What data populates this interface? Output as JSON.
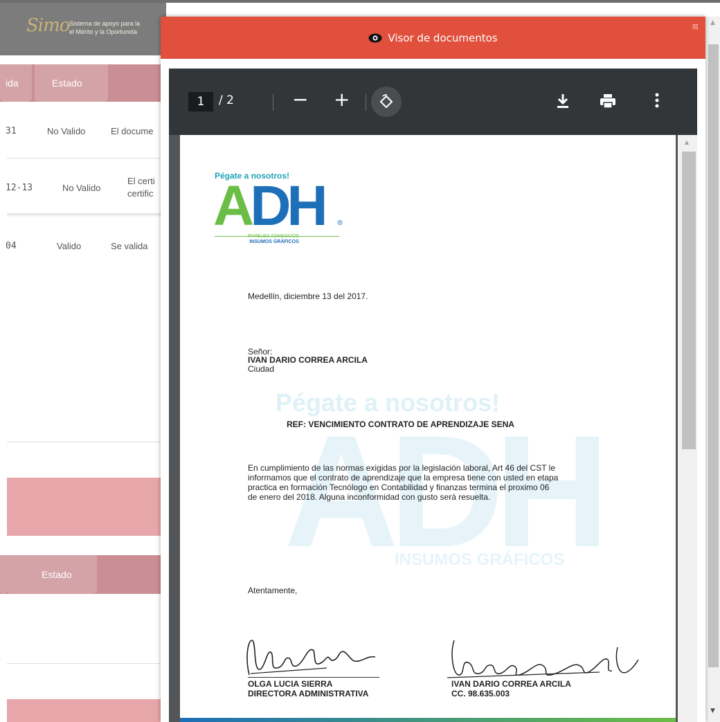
{
  "background": {
    "logo_text": "Simo",
    "logo_tagline_1": "Sistema de apoyo para la",
    "logo_tagline_2": "el Mérito y la Oportunida",
    "table1": {
      "col_partial": "ida",
      "col_estado": "Estado",
      "rows": [
        {
          "date": "31",
          "estado": "No Valido",
          "obs": "El docume"
        },
        {
          "date": "12-13",
          "estado": "No Valido",
          "obs_1": "El certi",
          "obs_2": "certific"
        },
        {
          "date": "04",
          "estado": "Valido",
          "obs": "Se valida"
        }
      ]
    },
    "table2": {
      "col_estado": "Estado"
    }
  },
  "modal": {
    "title": "Visor de documentos",
    "close": "⊠"
  },
  "viewer": {
    "current_page": "1",
    "page_sep": "/ 2",
    "zoom_out": "−",
    "zoom_in": "+",
    "download": "⤓",
    "print": "⎙",
    "more": "⋮"
  },
  "document": {
    "slogan": "Pégate a nosotros!",
    "logo_a": "A",
    "logo_dh": "DH",
    "logo_r": "®",
    "logo_sub_1": "PAPELES ADHESIVOS",
    "logo_sub_2": "INSUMOS GRÁFICOS",
    "date_line": "Medellín, diciembre 13 del 2017.",
    "salutation": "Señor:",
    "recipient": "IVAN DARIO CORREA ARCILA",
    "city": "Ciudad",
    "ref": "REF: VENCIMIENTO CONTRATO DE  APRENDIZAJE SENA",
    "body_1": "En cumplimiento de las normas exigidas por la legislación laboral, Art 46 del CST le",
    "body_2": "informamos que el contrato de aprendizaje que la empresa tiene con usted en etapa",
    "body_3": "practica en formación  Tecnólogo en Contabilidad y finanzas termina el proximo 06",
    "body_4": "de enero del 2018.  Alguna inconformidad con gusto será resuelta.",
    "closing": "Atentamente,",
    "signer1_name": "OLGA LUCIA SIERRA",
    "signer1_title": "DIRECTORA ADMINISTRATIVA",
    "signer2_name": "IVAN DARIO CORREA ARCILA",
    "signer2_id": "CC. 98.635.003",
    "watermark_slogan": "Pégate a nosotros!",
    "watermark_logo": "ADH",
    "watermark_sub": "INSUMOS GRÁFICOS"
  },
  "colors": {
    "modal_header": "#e0503c",
    "table_header": "#c98f95",
    "adh_green": "#6cbd45",
    "adh_blue": "#1d6fb7"
  }
}
